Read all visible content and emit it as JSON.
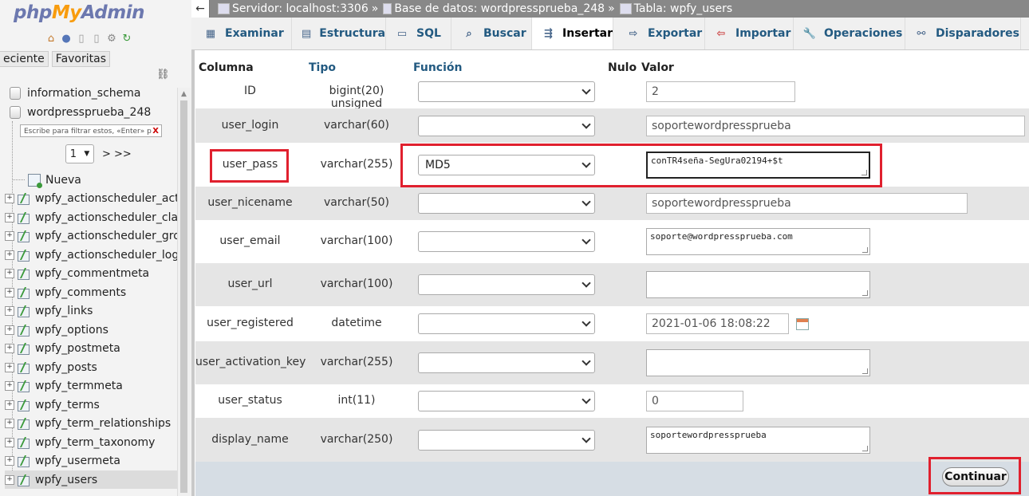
{
  "sidebar": {
    "logo_php": "php",
    "logo_my": "My",
    "logo_admin": "Admin",
    "tabs": [
      "eciente",
      "Favoritas"
    ],
    "chain_icon": "link-icon",
    "databases": [
      "information_schema",
      "wordpressprueba_248"
    ],
    "filter_placeholder": "Escribe para filtrar estos, «Enter» p",
    "filter_clear": "X",
    "page_select": "1",
    "page_next": "> >>",
    "new_label": "Nueva",
    "tables": [
      "wpfy_actionscheduler_acti",
      "wpfy_actionscheduler_clair",
      "wpfy_actionscheduler_grou",
      "wpfy_actionscheduler_logs",
      "wpfy_commentmeta",
      "wpfy_comments",
      "wpfy_links",
      "wpfy_options",
      "wpfy_postmeta",
      "wpfy_posts",
      "wpfy_termmeta",
      "wpfy_terms",
      "wpfy_term_relationships",
      "wpfy_term_taxonomy",
      "wpfy_usermeta",
      "wpfy_users"
    ],
    "active_table": "wpfy_users"
  },
  "breadcrumb": {
    "back": "←",
    "server": "Servidor: localhost:3306",
    "sep": "»",
    "database": "Base de datos: wordpressprueba_248",
    "table": "Tabla: wpfy_users"
  },
  "tabs": [
    {
      "label": "Examinar",
      "icon": "browse-icon"
    },
    {
      "label": "Estructura",
      "icon": "structure-icon"
    },
    {
      "label": "SQL",
      "icon": "sql-icon"
    },
    {
      "label": "Buscar",
      "icon": "search-icon"
    },
    {
      "label": "Insertar",
      "icon": "insert-icon"
    },
    {
      "label": "Exportar",
      "icon": "export-icon"
    },
    {
      "label": "Importar",
      "icon": "import-icon"
    },
    {
      "label": "Operaciones",
      "icon": "wrench-icon"
    },
    {
      "label": "Disparadores",
      "icon": "triggers-icon"
    }
  ],
  "active_tab": "Insertar",
  "headers": {
    "column": "Columna",
    "type": "Tipo",
    "function": "Función",
    "null": "Nulo",
    "value": "Valor"
  },
  "rows": [
    {
      "column": "ID",
      "type": "bigint(20) unsigned",
      "function": "",
      "value": "2"
    },
    {
      "column": "user_login",
      "type": "varchar(60)",
      "function": "",
      "value": "soportewordpressprueba"
    },
    {
      "column": "user_pass",
      "type": "varchar(255)",
      "function": "MD5",
      "value": "conTR4seña-SegUra02194+$t"
    },
    {
      "column": "user_nicename",
      "type": "varchar(50)",
      "function": "",
      "value": "soportewordpressprueba"
    },
    {
      "column": "user_email",
      "type": "varchar(100)",
      "function": "",
      "value": "soporte@wordpressprueba.com"
    },
    {
      "column": "user_url",
      "type": "varchar(100)",
      "function": "",
      "value": ""
    },
    {
      "column": "user_registered",
      "type": "datetime",
      "function": "",
      "value": "2021-01-06 18:08:22"
    },
    {
      "column": "user_activation_key",
      "type": "varchar(255)",
      "function": "",
      "value": ""
    },
    {
      "column": "user_status",
      "type": "int(11)",
      "function": "",
      "value": "0"
    },
    {
      "column": "display_name",
      "type": "varchar(250)",
      "function": "",
      "value": "soportewordpressprueba"
    }
  ],
  "continue_button": "Continuar",
  "highlight_color": "#e0202e"
}
